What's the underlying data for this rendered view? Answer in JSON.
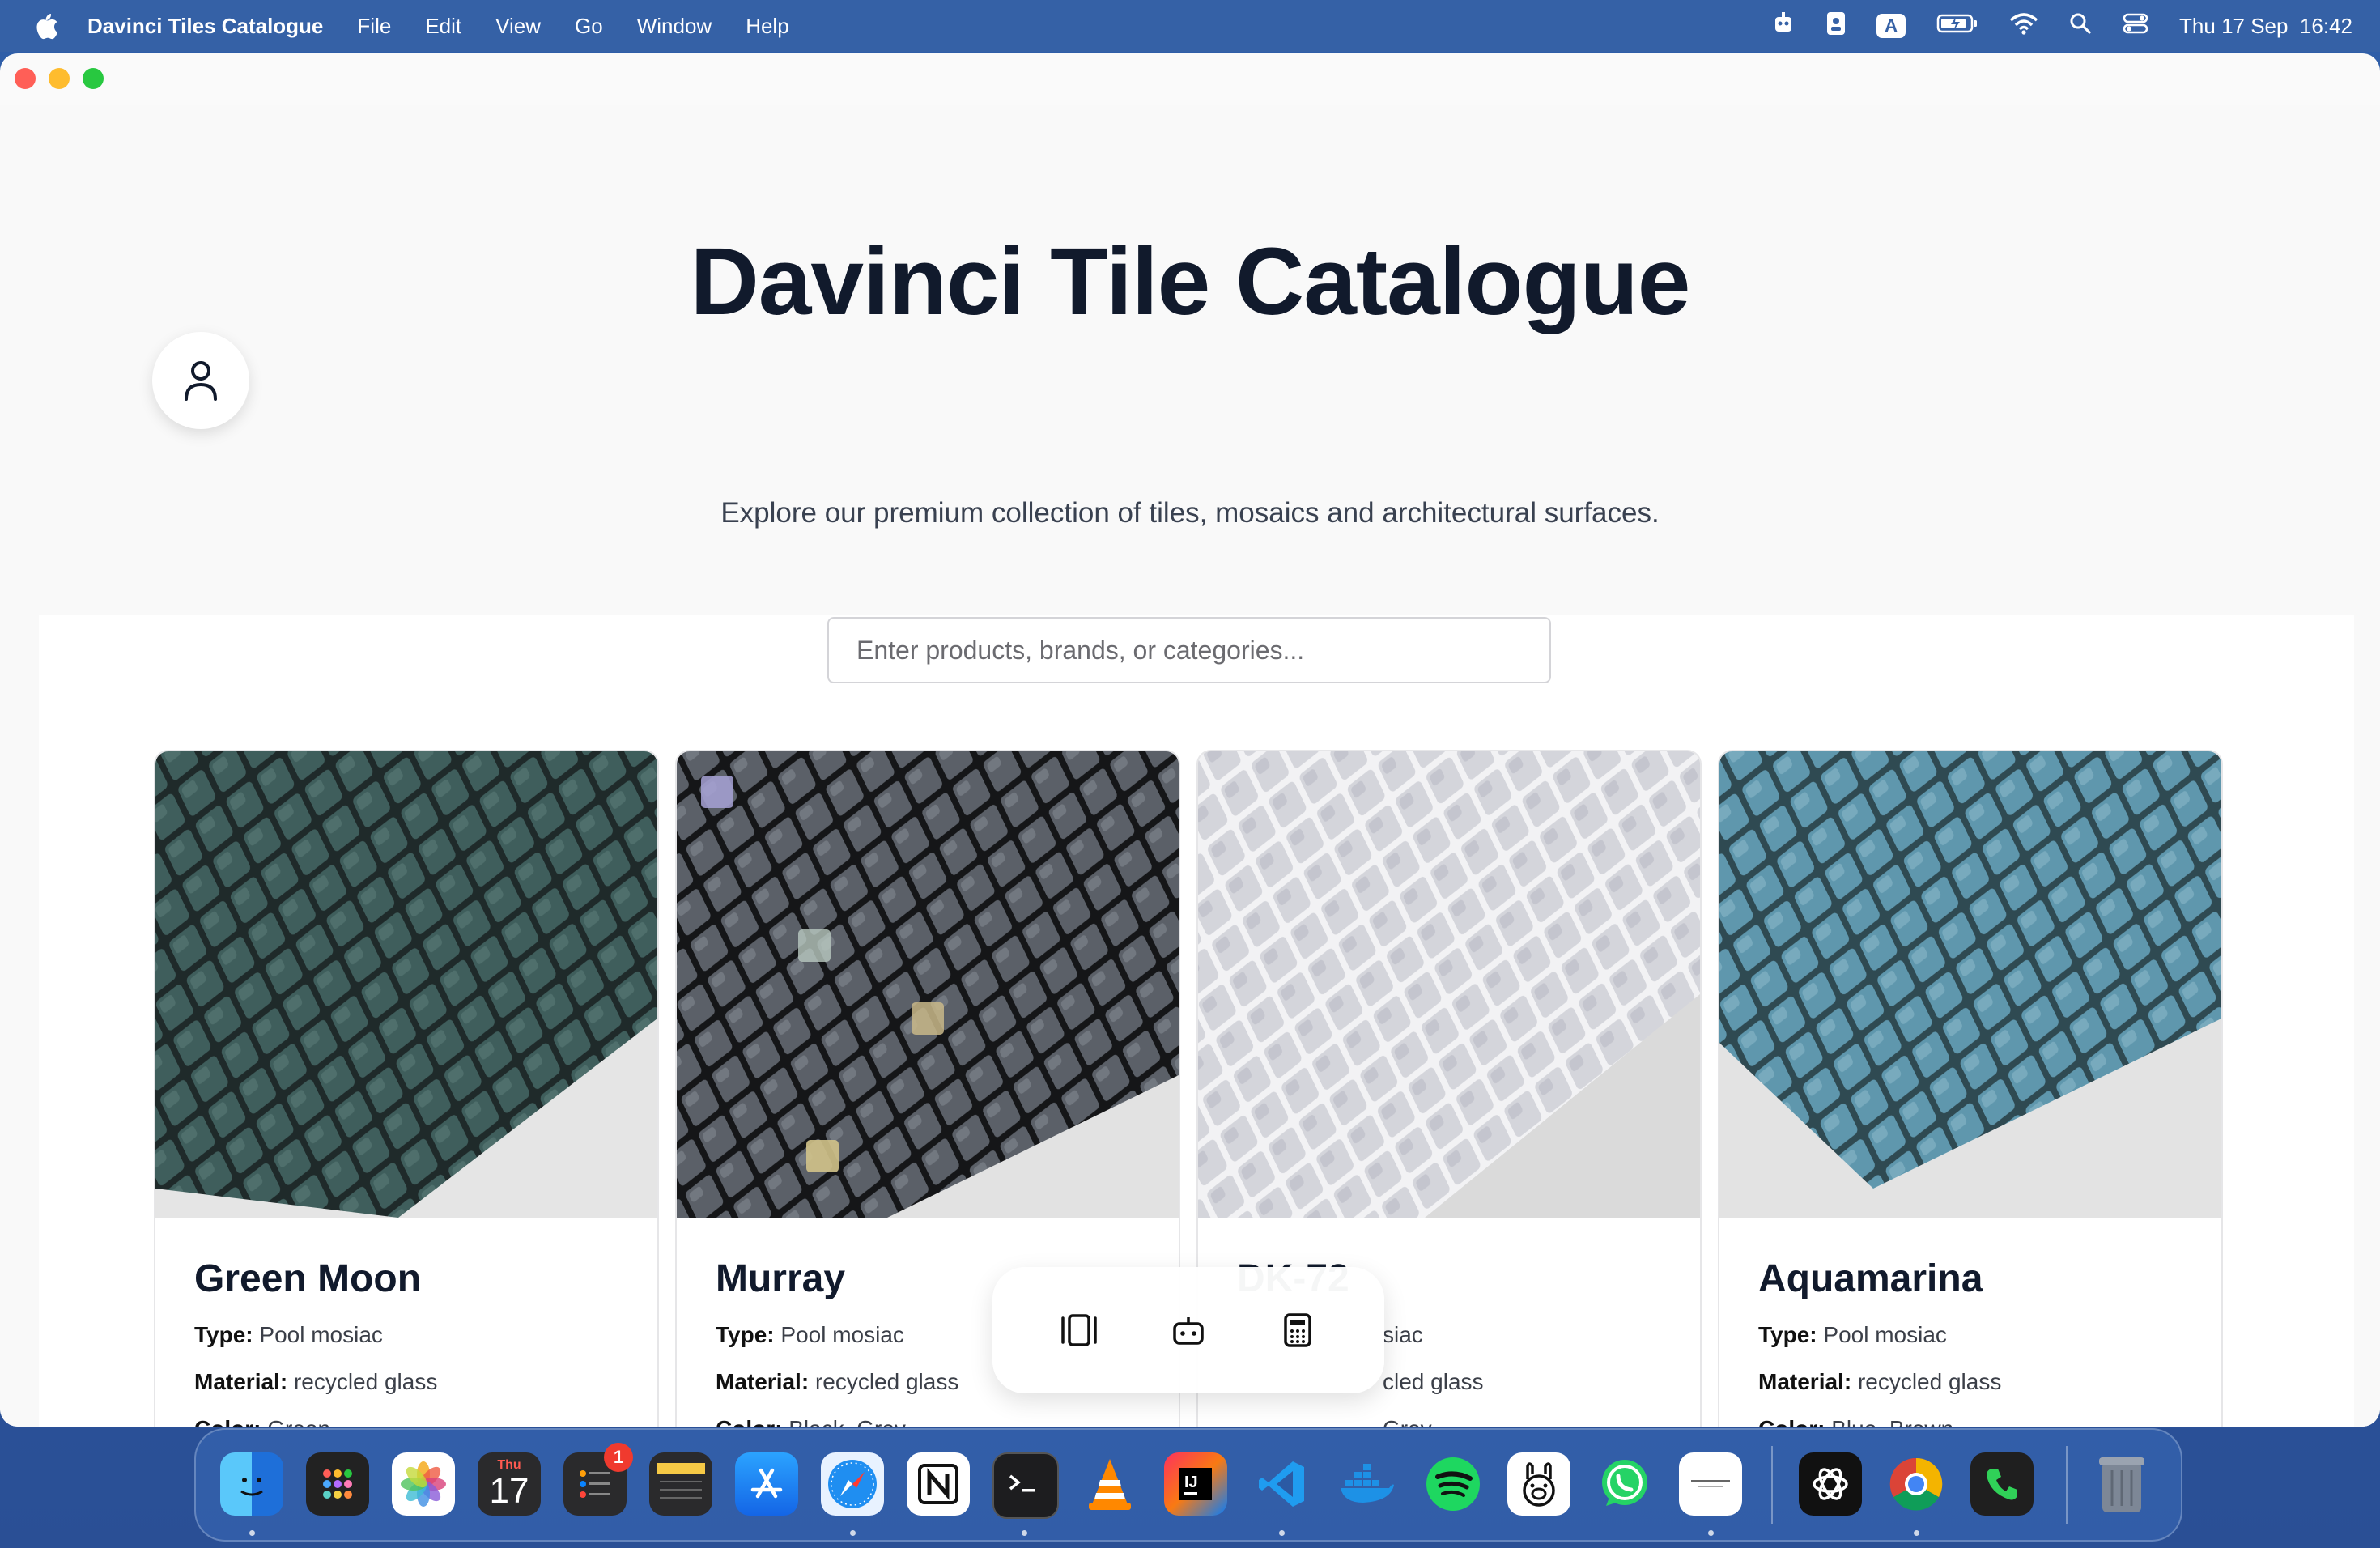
{
  "menubar": {
    "app_name": "Davinci Tiles Catalogue",
    "items": [
      "File",
      "Edit",
      "View",
      "Go",
      "Window",
      "Help"
    ],
    "input_indicator": "A",
    "datetime": "Thu 17 Sep  16:42"
  },
  "page": {
    "title": "Davinci Tile Catalogue",
    "subtitle": "Explore our premium collection of tiles, mosaics and architectural surfaces.",
    "search_placeholder": "Enter products, brands, or categories..."
  },
  "labels": {
    "type": "Type:",
    "material": "Material:",
    "color": "Color:"
  },
  "products": [
    {
      "name": "Green Moon",
      "type": "Pool mosiac",
      "material": "recycled glass",
      "color": "Green"
    },
    {
      "name": "Murray",
      "type": "Pool mosiac",
      "material": "recycled glass",
      "color": "Black, Grey"
    },
    {
      "name": "DK-72",
      "type": "siac",
      "material": "cled glass",
      "color": "Grey"
    },
    {
      "name": "Aquamarina",
      "type": "Pool mosiac",
      "material": "recycled glass",
      "color": "Blue, Brown"
    }
  ],
  "floating_toolbar": [
    "carousel-icon",
    "robot-icon",
    "calculator-icon"
  ],
  "dock": {
    "calendar_month": "Thu",
    "calendar_day": "17",
    "reminders_badge": "1"
  },
  "colors": {
    "title": "#111a2c",
    "desktop": "#2f5ea8",
    "green_tile": "#3f5e5c",
    "grey_tile": "#5b6068",
    "light_tile": "#d4d5db",
    "aqua_tile": "#5f97ad"
  }
}
